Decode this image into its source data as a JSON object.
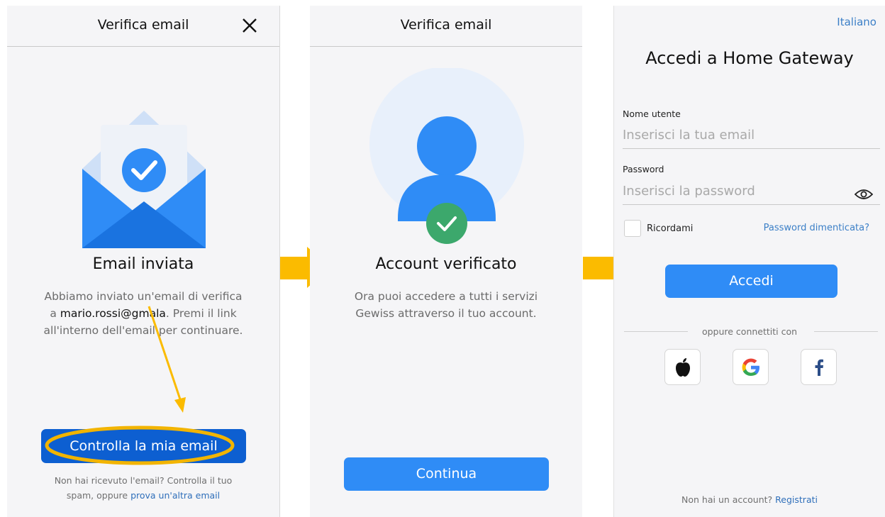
{
  "screen1": {
    "header_title": "Verifica email",
    "heading": "Email inviata",
    "body_line1": "Abbiamo inviato un'email di verifica",
    "body_line2_prefix": "a ",
    "body_email": "mario.rossi@gmala",
    "body_line2_suffix": ". Premi il link",
    "body_line3": "all'interno dell'email per continuare.",
    "button_label": "Controlla la mia email",
    "footer_line1": "Non hai ricevuto l'email? Controlla il tuo",
    "footer_line2_prefix": "spam, oppure ",
    "footer_link": "prova un'altra email"
  },
  "screen2": {
    "header_title": "Verifica email",
    "heading": "Account verificato",
    "body_line1": "Ora puoi accedere a tutti i servizi",
    "body_line2": "Gewiss attraverso il tuo account.",
    "button_label": "Continua"
  },
  "screen3": {
    "language": "Italiano",
    "title": "Accedi a Home Gateway",
    "username_label": "Nome utente",
    "username_placeholder": "Inserisci la tua email",
    "password_label": "Password",
    "password_placeholder": "Inserisci la password",
    "remember_label": "Ricordami",
    "forgot_link": "Password dimenticata?",
    "login_button": "Accedi",
    "divider_text": "oppure connettiti con",
    "social": [
      "apple-icon",
      "google-icon",
      "facebook-icon"
    ],
    "footer_prefix": "Non hai un account? ",
    "footer_link": "Registrati"
  },
  "colors": {
    "primary_blue": "#2f8cf6",
    "highlight_yellow": "#fbbb00",
    "link_blue": "#2f6fba"
  }
}
